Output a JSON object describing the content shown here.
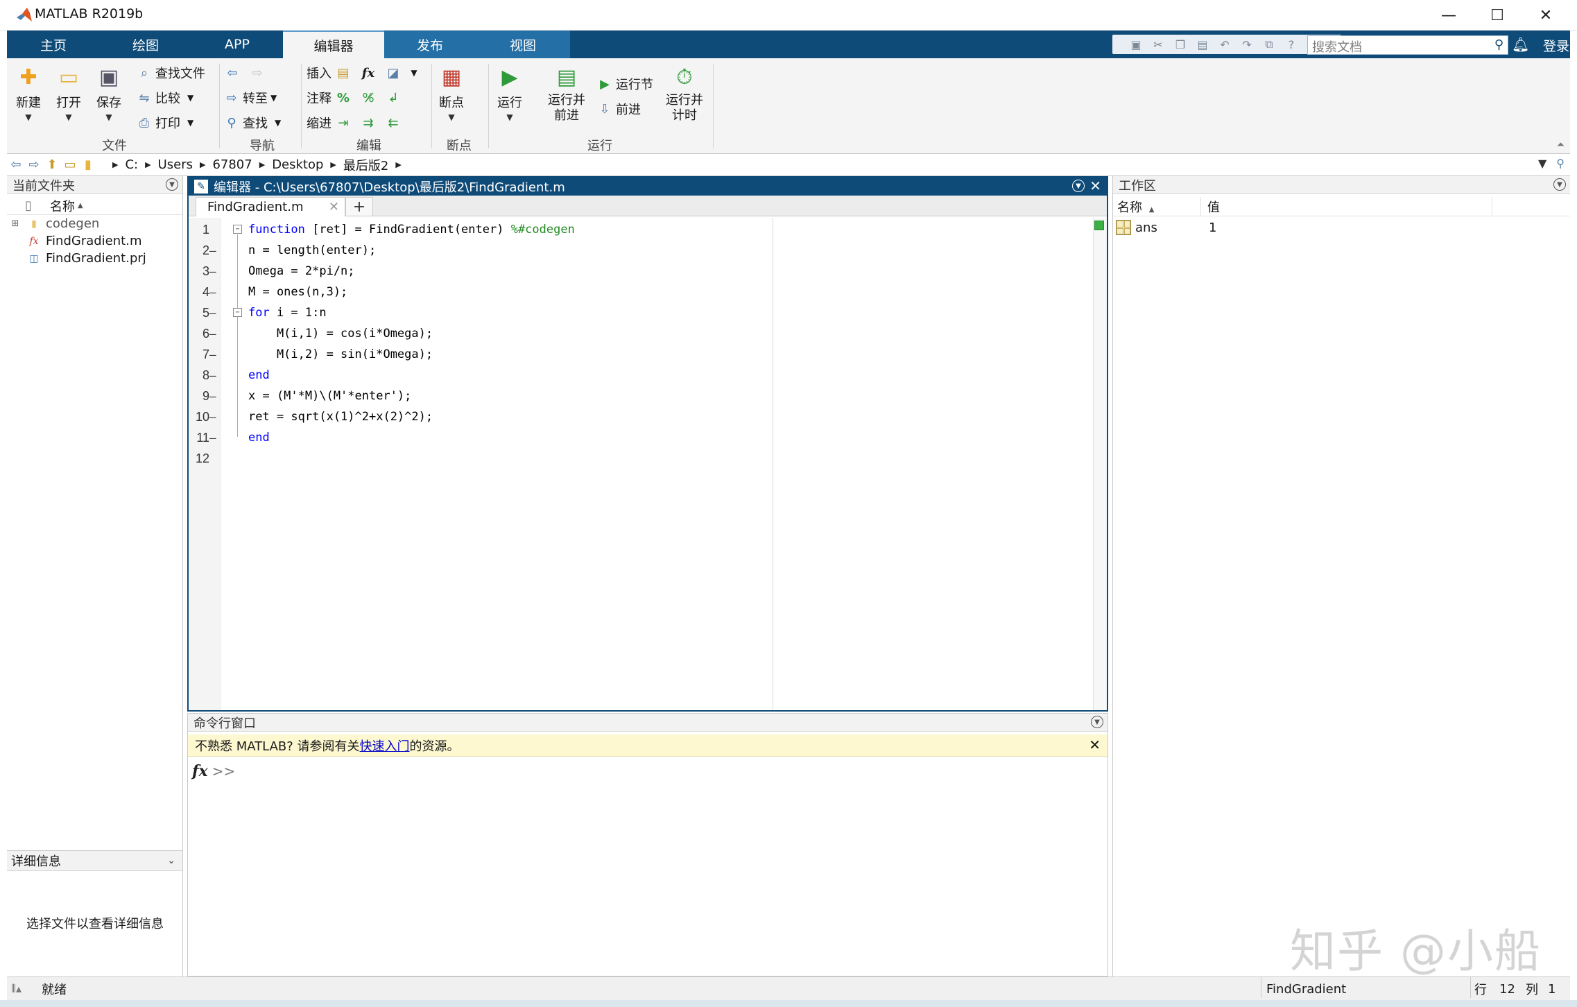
{
  "window": {
    "title": "MATLAB R2019b",
    "controls": [
      "—",
      "☐",
      "✕"
    ]
  },
  "tabs": [
    {
      "label": "主页"
    },
    {
      "label": "绘图"
    },
    {
      "label": "APP"
    },
    {
      "label": "编辑器"
    },
    {
      "label": "发布"
    },
    {
      "label": "视图"
    }
  ],
  "search": {
    "placeholder": "搜索文档"
  },
  "login_label": "登录",
  "ribbon": {
    "file": {
      "group_label": "文件",
      "new_label": "新建",
      "open_label": "打开",
      "save_label": "保存",
      "find_files_label": "查找文件",
      "compare_label": "比较",
      "print_label": "打印"
    },
    "navigate": {
      "group_label": "导航",
      "goto_label": "转至",
      "find_label": "查找"
    },
    "edit": {
      "group_label": "编辑",
      "insert_label": "插入",
      "comment_label": "注释",
      "indent_label": "缩进",
      "fx_label": "fx"
    },
    "breakpoints": {
      "group_label": "断点",
      "breakpoints_label": "断点"
    },
    "run": {
      "group_label": "运行",
      "run_label": "运行",
      "run_advance_label": "运行并\n前进",
      "run_section_label": "运行节",
      "advance_label": "前进",
      "run_time_label": "运行并\n计时"
    }
  },
  "breadcrumb": [
    "C:",
    "Users",
    "67807",
    "Desktop",
    "最后版2"
  ],
  "current_folder": {
    "title": "当前文件夹",
    "column_name": "名称",
    "items": [
      {
        "name": "codegen",
        "kind": "folder"
      },
      {
        "name": "FindGradient.m",
        "kind": "mfile"
      },
      {
        "name": "FindGradient.prj",
        "kind": "prj"
      }
    ],
    "details_title": "详细信息",
    "details_text": "选择文件以查看详细信息"
  },
  "editor": {
    "title": "编辑器 - C:\\Users\\67807\\Desktop\\最后版2\\FindGradient.m",
    "tab_label": "FindGradient.m",
    "add_tab": "+",
    "lines": [
      {
        "num": "1",
        "dash": "",
        "code": [
          {
            "t": "function",
            "c": "kw"
          },
          {
            "t": " [ret] = FindGradient(enter) ",
            "c": ""
          },
          {
            "t": "%#codegen",
            "c": "cm"
          }
        ]
      },
      {
        "num": "2",
        "dash": "—",
        "code": [
          {
            "t": "n = length(enter);",
            "c": ""
          }
        ]
      },
      {
        "num": "3",
        "dash": "—",
        "code": [
          {
            "t": "Omega = 2*pi/n;",
            "c": ""
          }
        ]
      },
      {
        "num": "4",
        "dash": "—",
        "code": [
          {
            "t": "M = ones(n,3);",
            "c": ""
          }
        ]
      },
      {
        "num": "5",
        "dash": "—",
        "code": [
          {
            "t": "for",
            "c": "kw"
          },
          {
            "t": " i = 1:n",
            "c": ""
          }
        ]
      },
      {
        "num": "6",
        "dash": "—",
        "code": [
          {
            "t": "    M(i,1) = cos(i*Omega);",
            "c": ""
          }
        ]
      },
      {
        "num": "7",
        "dash": "—",
        "code": [
          {
            "t": "    M(i,2) = sin(i*Omega);",
            "c": ""
          }
        ]
      },
      {
        "num": "8",
        "dash": "—",
        "code": [
          {
            "t": "end",
            "c": "kw"
          }
        ]
      },
      {
        "num": "9",
        "dash": "—",
        "code": [
          {
            "t": "x = (M'*M)\\(M'*enter');",
            "c": ""
          }
        ]
      },
      {
        "num": "10",
        "dash": "—",
        "code": [
          {
            "t": "ret = sqrt(x(1)^2+x(2)^2);",
            "c": ""
          }
        ]
      },
      {
        "num": "11",
        "dash": "—",
        "code": [
          {
            "t": "end",
            "c": "kw"
          }
        ]
      },
      {
        "num": "12",
        "dash": "",
        "code": []
      }
    ]
  },
  "command_window": {
    "title": "命令行窗口",
    "banner_prefix": "不熟悉 MATLAB? 请参阅有关",
    "banner_link": "快速入门",
    "banner_suffix": "的资源。",
    "fx": "fx",
    "prompt": ">>"
  },
  "workspace": {
    "title": "工作区",
    "col_name": "名称",
    "col_value": "值",
    "rows": [
      {
        "name": "ans",
        "value": "1"
      }
    ]
  },
  "watermark": "知乎 @小船",
  "status": {
    "ready": "就绪",
    "function_name": "FindGradient",
    "row_label": "行",
    "row": "12",
    "col_label": "列",
    "col": "1"
  },
  "colors": {
    "tabbar": "#0e4b78",
    "keyword": "#0000ff",
    "comment": "#228b22",
    "link": "#0000cc",
    "banner_bg": "#fdf8d0"
  }
}
